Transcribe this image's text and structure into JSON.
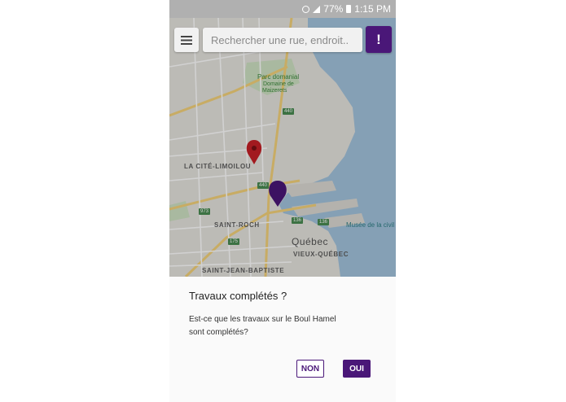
{
  "status_bar": {
    "battery": "77%",
    "time": "1:15 PM"
  },
  "search": {
    "placeholder": "Rechercher une rue, endroit.."
  },
  "alert_button": {
    "label": "!"
  },
  "map": {
    "labels": {
      "parc_domanial": "Parc domanial",
      "domaine_1": "Domaine de",
      "domaine_2": "Maizerets",
      "cite_limoilou": "LA CITÉ-LIMOILOU",
      "saint_roch": "SAINT-ROCH",
      "quebec": "Québec",
      "vieux_quebec": "VIEUX-QUÉBEC",
      "saint_jean": "SAINT-JEAN-BAPTISTE",
      "musee": "Musée de la civil"
    },
    "shields": [
      "440",
      "440",
      "973",
      "175",
      "136",
      "136"
    ],
    "colors": {
      "water": "#a3c4dd",
      "land": "#e6e4de",
      "park": "#cfe2c4",
      "road": "#f4d27a",
      "pin_red": "#c62026",
      "pin_purple": "#4a1778"
    }
  },
  "dialog": {
    "title": "Travaux complétés ?",
    "message": "Est-ce que les travaux sur le Boul Hamel sont complétés?",
    "no_label": "NON",
    "yes_label": "OUI"
  }
}
